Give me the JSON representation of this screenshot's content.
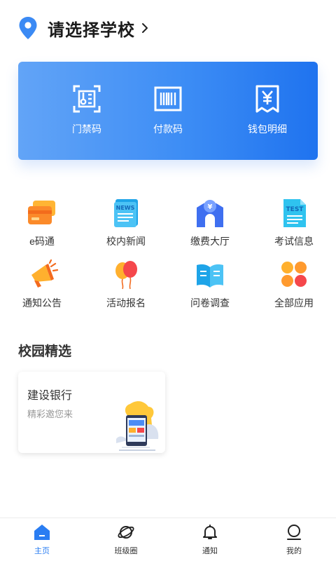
{
  "header": {
    "title": "请选择学校"
  },
  "quick_actions": [
    {
      "label": "门禁码",
      "icon": "access-qr-icon"
    },
    {
      "label": "付款码",
      "icon": "barcode-icon"
    },
    {
      "label": "钱包明细",
      "icon": "receipt-yuan-icon"
    }
  ],
  "apps": [
    {
      "label": "e码通",
      "icon": "card-icon"
    },
    {
      "label": "校内新闻",
      "icon": "news-icon"
    },
    {
      "label": "缴费大厅",
      "icon": "payment-hall-icon"
    },
    {
      "label": "考试信息",
      "icon": "test-doc-icon"
    },
    {
      "label": "通知公告",
      "icon": "megaphone-icon"
    },
    {
      "label": "活动报名",
      "icon": "balloons-icon"
    },
    {
      "label": "问卷调查",
      "icon": "book-icon"
    },
    {
      "label": "全部应用",
      "icon": "clover-grid-icon"
    }
  ],
  "section": {
    "title": "校园精选"
  },
  "promo": {
    "title": "建设银行",
    "subtitle": "精彩邀您来"
  },
  "tabbar": [
    {
      "label": "主页",
      "active": true
    },
    {
      "label": "班级圈",
      "active": false
    },
    {
      "label": "通知",
      "active": false
    },
    {
      "label": "我的",
      "active": false
    }
  ],
  "colors": {
    "accent": "#2a7df2",
    "card_start": "#62a4f7",
    "card_end": "#1f73ef"
  }
}
